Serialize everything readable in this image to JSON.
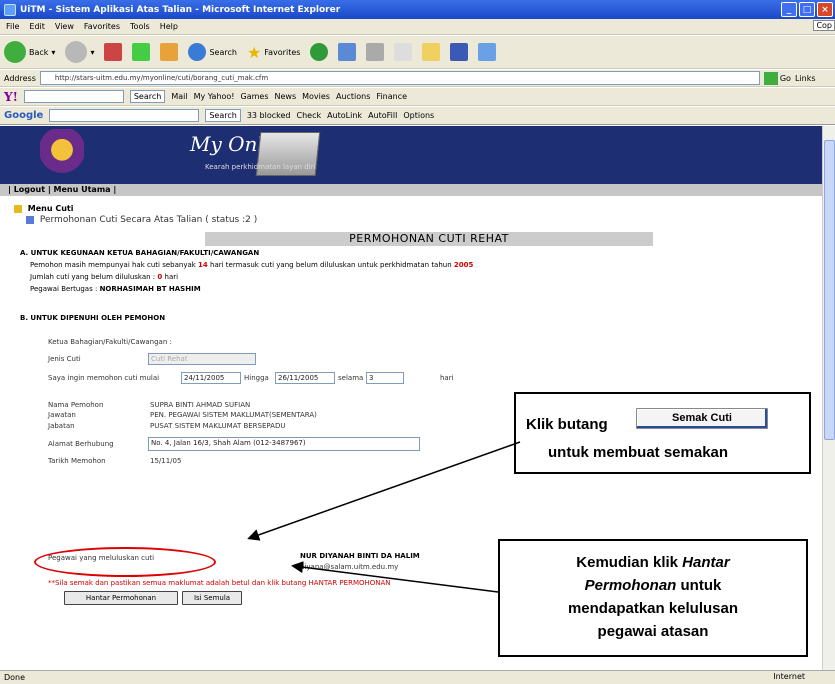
{
  "window": {
    "title": "UiTM - Sistem Aplikasi Atas Talian - Microsoft Internet Explorer",
    "clipped_label": "Cop"
  },
  "menubar": {
    "items": [
      "File",
      "Edit",
      "View",
      "Favorites",
      "Tools",
      "Help"
    ]
  },
  "toolbar": {
    "back": "Back",
    "search": "Search",
    "favorites": "Favorites"
  },
  "address": {
    "label": "Address",
    "url": "http://stars-uitm.edu.my/myonline/cuti/borang_cuti_mak.cfm",
    "go": "Go",
    "links": "Links"
  },
  "yahoobar": {
    "brand": "Y!",
    "search": "Search",
    "mail": "Mail",
    "my_yahoo": "My Yahoo!",
    "games": "Games",
    "news": "News",
    "movies": "Movies",
    "auctions": "Auctions",
    "finance": "Finance"
  },
  "googlebar": {
    "brand": "Google",
    "search": "Search",
    "blocked": "33 blocked",
    "check": "Check",
    "autolink": "AutoLink",
    "autofill": "AutoFill",
    "options": "Options"
  },
  "banner": {
    "title": "My Online",
    "subtitle": "Kearah perkhidmatan layan diri"
  },
  "logout": {
    "label": "| Logout | Menu Utama |"
  },
  "menu": {
    "root": "Menu Cuti",
    "child": "Permohonan Cuti Secara Atas Talian ( status :2 )"
  },
  "form": {
    "heading": "PERMOHONAN CUTI REHAT",
    "section_a": {
      "title": "A. UNTUK KEGUNAAN KETUA BAHAGIAN/FAKULTI/CAWANGAN",
      "line1_pre": "Pemohon masih mempunyai hak cuti sebanyak",
      "days": "14",
      "line1_post": "hari termasuk cuti yang belum diluluskan untuk perkhidmatan tahun",
      "year": "2005",
      "pending_label": "Jumlah cuti yang belum diluluskan :",
      "pending_value": "0",
      "pending_unit": "hari",
      "officer_label": "Pegawai Bertugas :",
      "officer_value": "NORHASIMAH BT HASHIM"
    },
    "section_b": {
      "title": "B. UNTUK DIPENUHI OLEH PEMOHON",
      "dept_label": "Ketua Bahagian/Fakulti/Cawangan :",
      "type_label": "Jenis Cuti",
      "type_value": "Cuti Rehat",
      "apply_label": "Saya ingin memohon cuti mulai",
      "start_date": "24/11/2005",
      "until_label": "Hingga",
      "end_date": "26/11/2005",
      "for_label": "selama",
      "days_value": "3",
      "days_unit": "hari",
      "name_label": "Nama Pemohon",
      "name_value": "SUPRA BINTI AHMAD SUFIAN",
      "post_label": "Jawatan",
      "post_value": "PEN. PEGAWAI SISTEM MAKLUMAT(SEMENTARA)",
      "dept2_label": "Jabatan",
      "dept2_value": "PUSAT SISTEM MAKLUMAT BERSEPADU",
      "address_label": "Alamat Berhubung",
      "address_value": "No. 4, Jalan 16/3, Shah Alam (012-3487967)",
      "date_label": "Tarikh Memohon",
      "date_value": "15/11/05",
      "approver_label": "Pegawai yang meluluskan cuti",
      "approver_name": "NUR DIYANAH BINTI DA HALIM",
      "approver_email": "diyana@salam.uitm.edu.my",
      "note": "**Sila semak dan pastikan semua maklumat adalah betul dan klik butang HANTAR PERMOHONAN",
      "submit": "Hantar Permohonan",
      "reset": "Isi Semula"
    }
  },
  "callout1": {
    "text1": "Klik butang",
    "button": "Semak Cuti",
    "text2": "untuk membuat semakan"
  },
  "callout2": {
    "line1": "Kemudian klik",
    "line1_italic": "Hantar",
    "line2_italic": "Permohonan",
    "line2": "untuk",
    "line3": "mendapatkan kelulusan",
    "line4": "pegawai atasan"
  },
  "status": {
    "left": "Done",
    "zone": "Internet"
  },
  "colors": {
    "banner": "#1e2e72",
    "accent_red": "#d00000",
    "titlebar": "#2a5ad8"
  }
}
